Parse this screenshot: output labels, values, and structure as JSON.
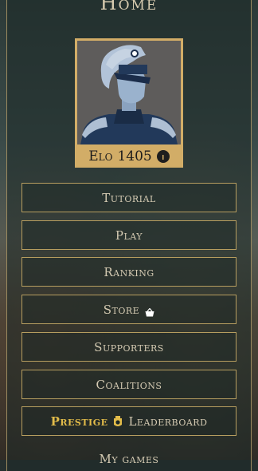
{
  "page": {
    "title": "Home"
  },
  "profile": {
    "elo_label": "Elo",
    "elo_value": "1405",
    "info_icon": "info-icon"
  },
  "menu": {
    "tutorial": "Tutorial",
    "play": "Play",
    "ranking": "Ranking",
    "store": "Store",
    "store_icon": "basket-icon",
    "supporters": "Supporters",
    "coalitions": "Coalitions",
    "prestige": "Prestige",
    "prestige_icon": "medal-icon",
    "leaderboard": "Leaderboard",
    "my_games": "My games"
  },
  "colors": {
    "gold_frame": "#d2ad67",
    "button_border": "#b69d5f",
    "prestige_gold": "#e2bc4a",
    "text": "#d5cbb3"
  }
}
